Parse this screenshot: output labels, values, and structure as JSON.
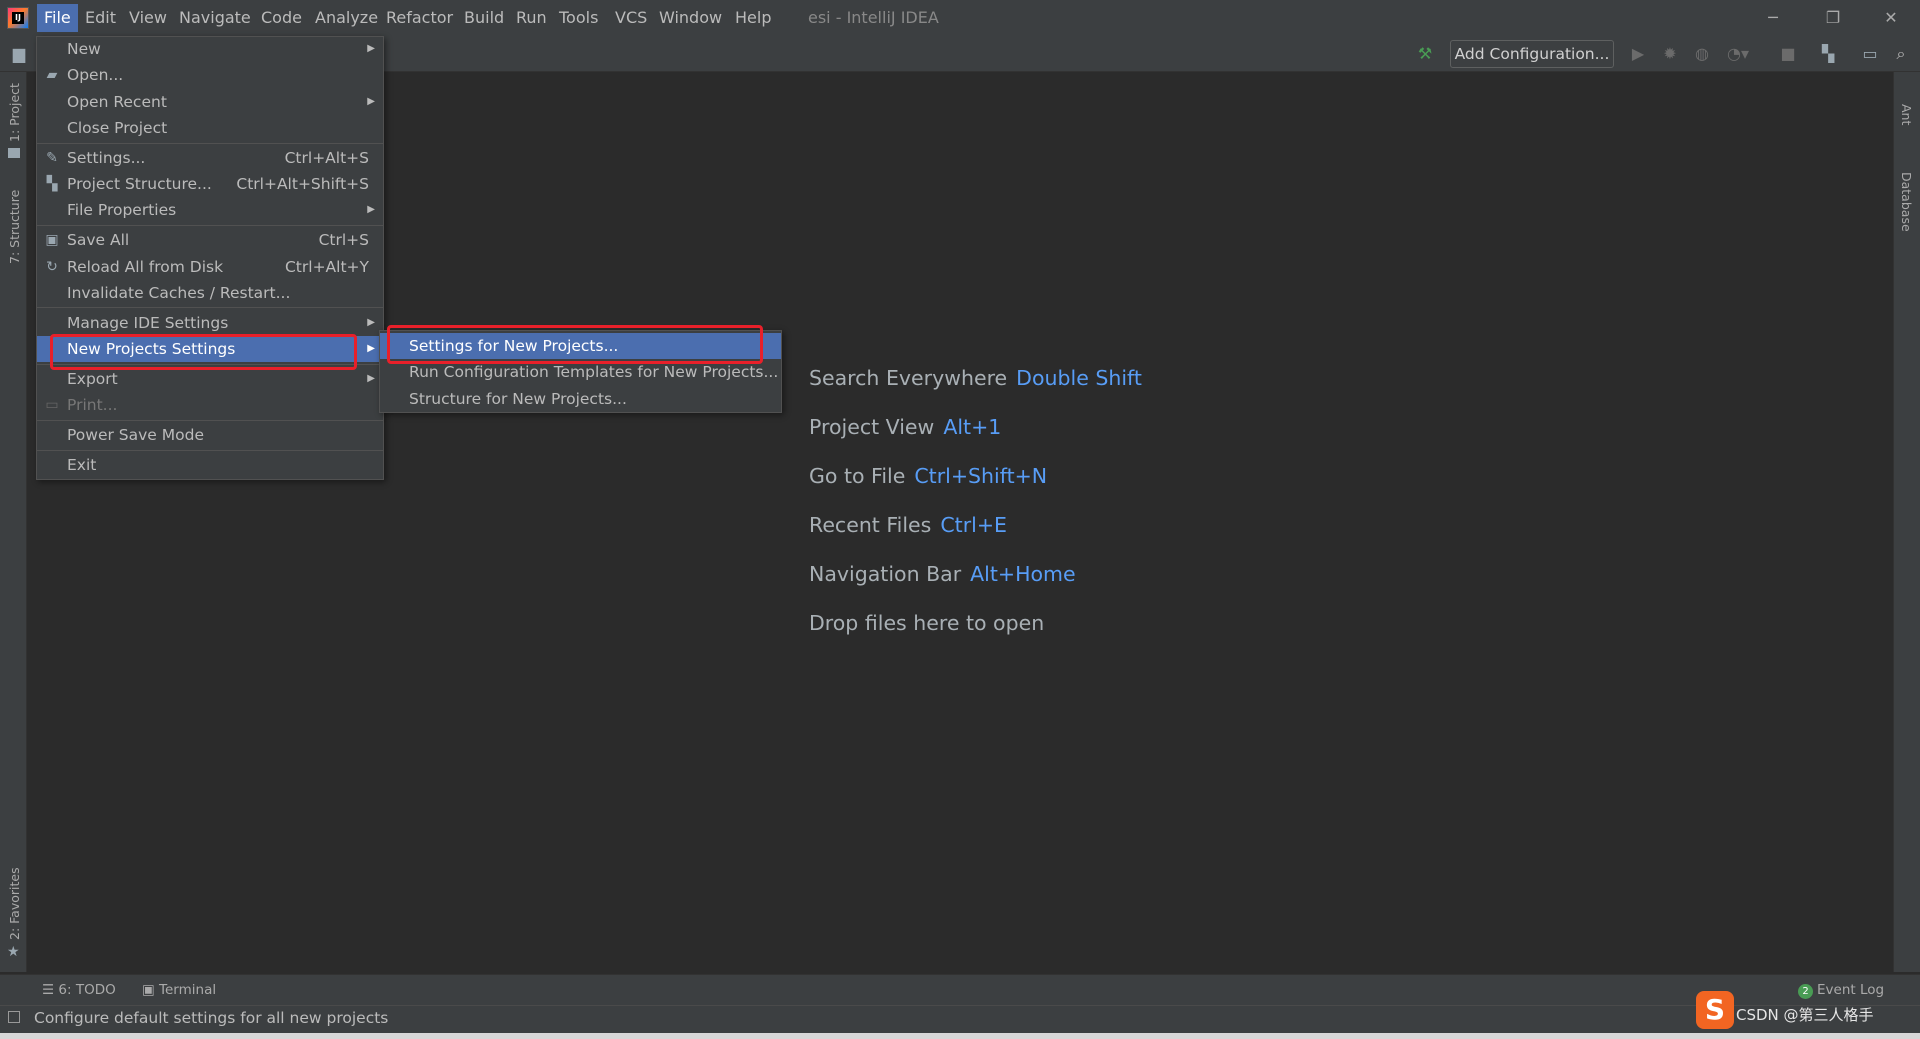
{
  "menubar": {
    "items": [
      "File",
      "Edit",
      "View",
      "Navigate",
      "Code",
      "Analyze",
      "Refactor",
      "Build",
      "Run",
      "Tools",
      "VCS",
      "Window",
      "Help"
    ],
    "window_title": "esi - IntelliJ IDEA"
  },
  "window_controls": {
    "minimize": "─",
    "restore": "❐",
    "close": "✕"
  },
  "toolbar": {
    "add_configuration": "Add Configuration..."
  },
  "file_menu": {
    "items": [
      {
        "label": "New",
        "submenu": true
      },
      {
        "label": "Open...",
        "icon": "folder-open-icon"
      },
      {
        "label": "Open Recent",
        "submenu": true
      },
      {
        "label": "Close Project"
      },
      {
        "label": "Settings...",
        "shortcut": "Ctrl+Alt+S",
        "icon": "wrench-icon"
      },
      {
        "label": "Project Structure...",
        "shortcut": "Ctrl+Alt+Shift+S",
        "icon": "project-structure-icon"
      },
      {
        "label": "File Properties",
        "submenu": true
      },
      {
        "label": "Save All",
        "shortcut": "Ctrl+S",
        "icon": "save-icon"
      },
      {
        "label": "Reload All from Disk",
        "shortcut": "Ctrl+Alt+Y",
        "icon": "reload-icon"
      },
      {
        "label": "Invalidate Caches / Restart..."
      },
      {
        "label": "Manage IDE Settings",
        "submenu": true
      },
      {
        "label": "New Projects Settings",
        "submenu": true,
        "selected": true
      },
      {
        "label": "Export",
        "submenu": true
      },
      {
        "label": "Print...",
        "disabled": true,
        "icon": "print-icon"
      },
      {
        "label": "Power Save Mode"
      },
      {
        "label": "Exit"
      }
    ]
  },
  "submenu": {
    "items": [
      {
        "label": "Settings for New Projects...",
        "selected": true
      },
      {
        "label": "Run Configuration Templates for New Projects..."
      },
      {
        "label": "Structure for New Projects..."
      }
    ]
  },
  "editor_hints": [
    {
      "text": "Search Everywhere",
      "key": "Double Shift"
    },
    {
      "text": "Project View",
      "key": "Alt+1"
    },
    {
      "text": "Go to File",
      "key": "Ctrl+Shift+N"
    },
    {
      "text": "Recent Files",
      "key": "Ctrl+E"
    },
    {
      "text": "Navigation Bar",
      "key": "Alt+Home"
    },
    {
      "text": "Drop files here to open",
      "key": ""
    }
  ],
  "left_stripe": {
    "project": "1: Project",
    "structure": "7: Structure",
    "favorites": "2: Favorites"
  },
  "right_stripe": {
    "ant": "Ant",
    "database": "Database"
  },
  "bottom_tabs": {
    "todo": "6: TODO",
    "terminal": "Terminal",
    "event_log": "Event Log",
    "event_count": "2"
  },
  "status_bar": {
    "text": "Configure default settings for all new projects"
  },
  "watermark": {
    "logo": "S",
    "text": "CSDN @第三人格手"
  },
  "colors": {
    "selection": "#4b6eaf",
    "shortcut_key": "#589df6",
    "highlight_box": "#e8202a",
    "background": "#2b2b2b"
  }
}
